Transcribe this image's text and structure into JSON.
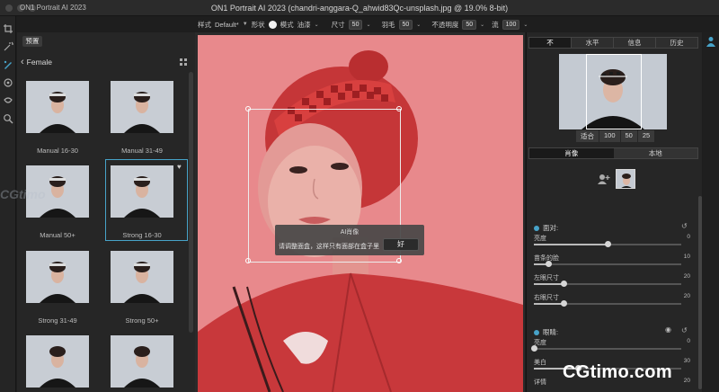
{
  "window": {
    "app_name": "ON1 Portrait AI 2023",
    "title": "ON1 Portrait AI 2023 (chandri-anggara-Q_ahwid83Qc-unsplash.jpg @ 19.0% 8-bit)"
  },
  "options_bar": {
    "style_label": "样式",
    "style_value": "Default*",
    "shape_label": "形状",
    "mode_label": "模式",
    "mode_value": "油漆",
    "size_label": "尺寸",
    "size_value": "50",
    "feather_label": "羽毛",
    "feather_value": "50",
    "opacity_label": "不透明度",
    "opacity_value": "50",
    "flow_label": "流",
    "flow_value": "100"
  },
  "presets": {
    "tab_label": "预置",
    "category": "Female",
    "items": [
      {
        "label": "Manual 16-30",
        "selected": false
      },
      {
        "label": "Manual 31-49",
        "selected": false
      },
      {
        "label": "Manual 50+",
        "selected": false
      },
      {
        "label": "Strong 16-30",
        "selected": true
      },
      {
        "label": "Strong 31-49",
        "selected": false
      },
      {
        "label": "Strong 50+",
        "selected": false
      }
    ]
  },
  "ai_dialog": {
    "title": "AI肖像",
    "message": "请调整面盒，这样只有面部在盒子里",
    "ok_label": "好"
  },
  "right_panel": {
    "tabs": [
      "不",
      "水平",
      "信息",
      "历史"
    ],
    "active_tab": 0,
    "zoom_options": [
      "适合",
      "100",
      "50",
      "25"
    ],
    "subtabs": [
      "肖像",
      "本地"
    ],
    "active_subtab": 0,
    "face_section": {
      "title": "面对:",
      "sliders": [
        {
          "label": "亮度",
          "value": "0",
          "position": 0.5
        },
        {
          "label": "苗条的脸",
          "value": "10",
          "position": 0.1
        },
        {
          "label": "左眼尺寸",
          "value": "20",
          "position": 0.2
        },
        {
          "label": "右眼尺寸",
          "value": "20",
          "position": 0.2
        }
      ]
    },
    "eyes_section": {
      "title": "眼睛:",
      "sliders": [
        {
          "label": "亮度",
          "value": "0",
          "position": 0.0
        },
        {
          "label": "美白",
          "value": "30",
          "position": 0.3
        },
        {
          "label": "详情",
          "value": "20",
          "position": 0.2
        }
      ]
    }
  },
  "watermarks": {
    "bottom_right": "CGtimo.com",
    "left": "CGtimo"
  },
  "colors": {
    "accent": "#47a3c9",
    "mask_overlay": "#e8898c"
  }
}
